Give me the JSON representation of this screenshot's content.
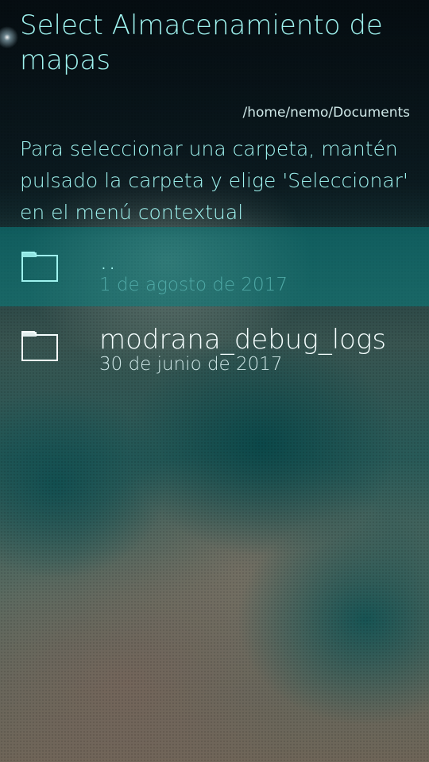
{
  "header": {
    "title": "Select Almacenamiento de mapas",
    "path": "/home/nemo/Documents",
    "hint": "Para seleccionar una carpeta, mantén pulsado la carpeta y elige 'Seleccionar' en el menú contextual"
  },
  "folders": [
    {
      "name": "..",
      "date": "1 de agosto de 2017",
      "icon": "folder-icon",
      "highlighted": true
    },
    {
      "name": "modrana_debug_logs",
      "date": "30 de junio de 2017",
      "icon": "folder-icon",
      "highlighted": false
    }
  ],
  "colors": {
    "accent": "#9ff3ef",
    "highlight": "#0a8080",
    "text": "#f5ffff"
  }
}
